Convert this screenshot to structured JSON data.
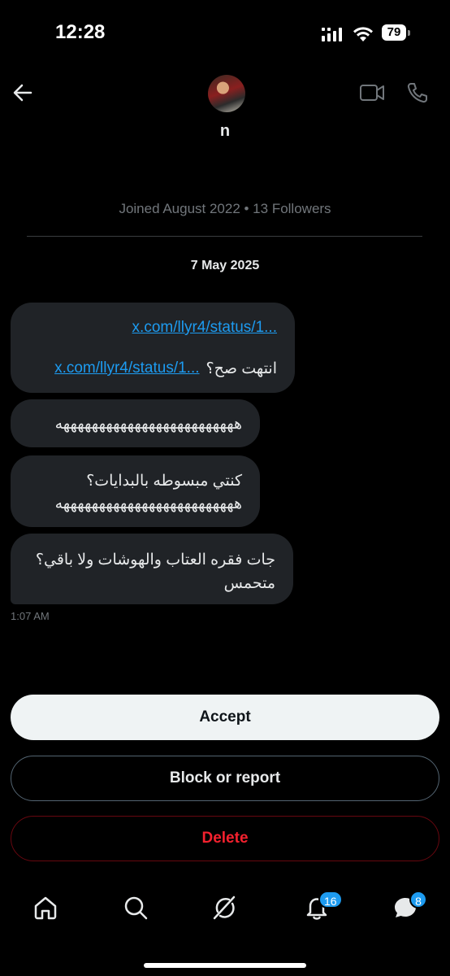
{
  "status_bar": {
    "time": "12:28",
    "battery": "79"
  },
  "header": {
    "name": "n"
  },
  "profile": {
    "joined": "Joined August 2022 • 13 Followers"
  },
  "conversation": {
    "date": "7 May 2025",
    "messages": [
      {
        "link1": "x.com/llyr4/status/1...",
        "text": "انتهت صح؟",
        "link2": "x.com/llyr4/status/1..."
      },
      {
        "text": "هههههههههههههههههههههههههه"
      },
      {
        "line1": "كنتي مبسوطه بالبدايات؟",
        "line2": "هههههههههههههههههههههههههه"
      },
      {
        "line1": "جات فقره العتاب والهوشات ولا باقي؟",
        "line2": "متحمس"
      }
    ],
    "timestamp": "1:07 AM"
  },
  "actions": {
    "accept": "Accept",
    "block": "Block or report",
    "delete": "Delete"
  },
  "nav": {
    "notifications_badge": "16",
    "messages_badge": "8"
  },
  "colors": {
    "accent": "#1d9bf0",
    "danger": "#f4212e",
    "bubble": "#202327"
  }
}
